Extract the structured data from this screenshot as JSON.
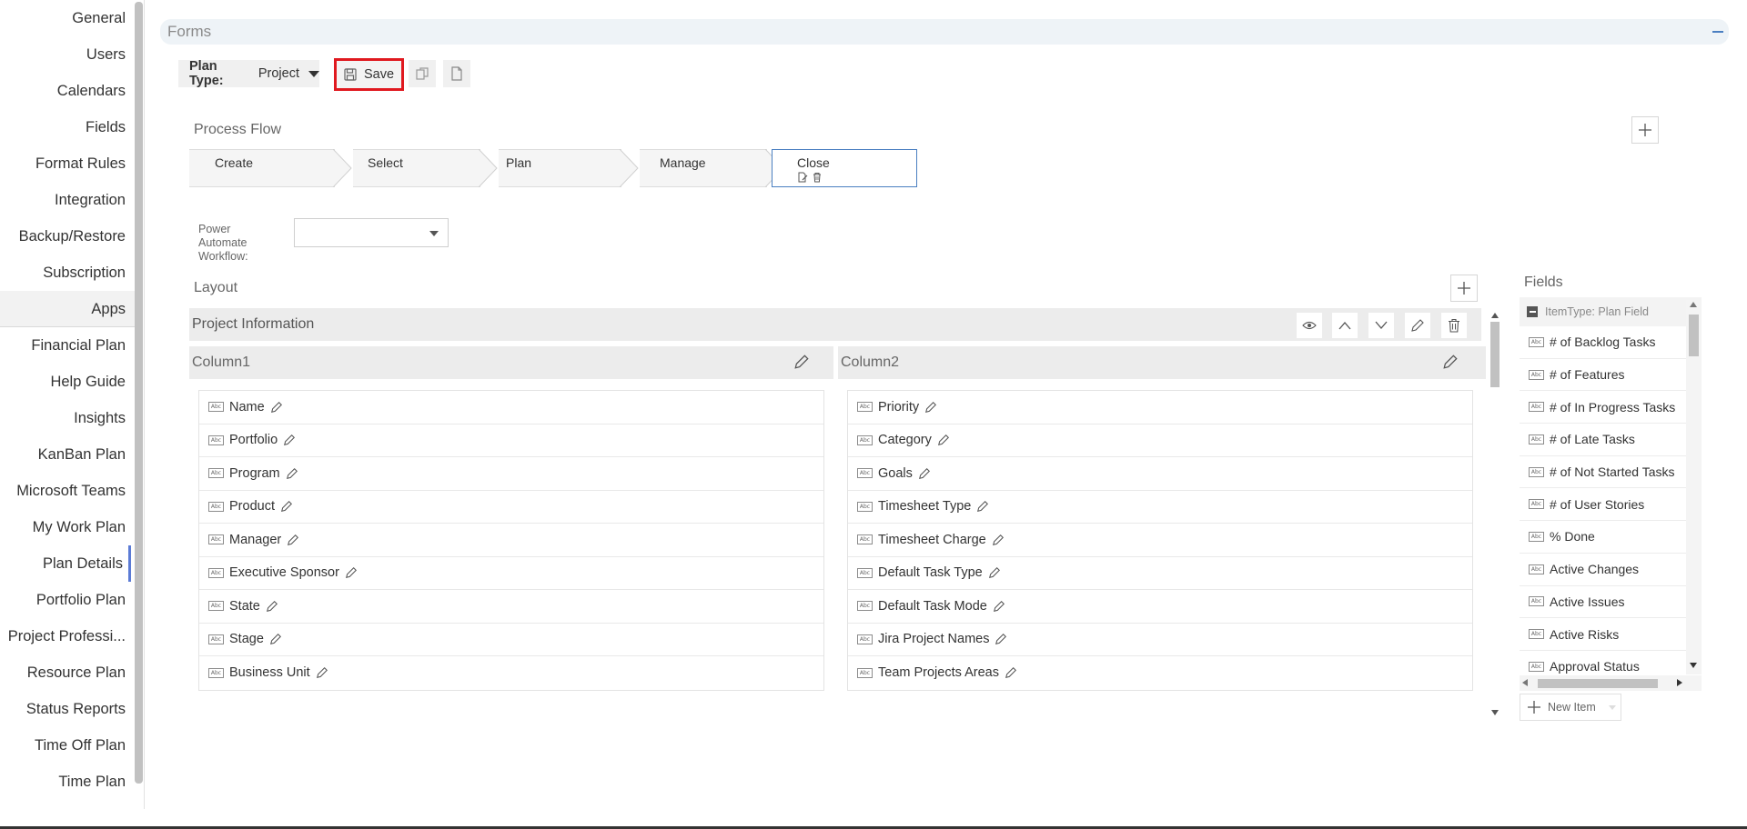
{
  "sidebar": {
    "items": [
      {
        "label": "General"
      },
      {
        "label": "Users"
      },
      {
        "label": "Calendars"
      },
      {
        "label": "Fields"
      },
      {
        "label": "Format Rules"
      },
      {
        "label": "Integration"
      },
      {
        "label": "Backup/Restore"
      },
      {
        "label": "Subscription"
      },
      {
        "label": "Apps"
      },
      {
        "label": "Financial Plan"
      },
      {
        "label": "Help Guide"
      },
      {
        "label": "Insights"
      },
      {
        "label": "KanBan Plan"
      },
      {
        "label": "Microsoft Teams"
      },
      {
        "label": "My Work Plan"
      },
      {
        "label": "Plan Details"
      },
      {
        "label": "Portfolio Plan"
      },
      {
        "label": "Project Professi..."
      },
      {
        "label": "Resource Plan"
      },
      {
        "label": "Status Reports"
      },
      {
        "label": "Time Off Plan"
      },
      {
        "label": "Time Plan"
      }
    ],
    "highlighted": "Apps",
    "selected": "Plan Details"
  },
  "forms": {
    "title": "Forms"
  },
  "toolbar": {
    "plan_type_label": "Plan Type:",
    "plan_type_value": "Project",
    "save_label": "Save"
  },
  "process_flow": {
    "title": "Process Flow",
    "steps": [
      {
        "label": "Create"
      },
      {
        "label": "Select"
      },
      {
        "label": "Plan"
      },
      {
        "label": "Manage"
      },
      {
        "label": "Close"
      }
    ]
  },
  "power_automate": {
    "label": "Power Automate Workflow:",
    "value": ""
  },
  "layout": {
    "title": "Layout",
    "section_title": "Project Information",
    "column1": {
      "title": "Column1",
      "fields": [
        "Name",
        "Portfolio",
        "Program",
        "Product",
        "Manager",
        "Executive Sponsor",
        "State",
        "Stage",
        "Business Unit"
      ]
    },
    "column2": {
      "title": "Column2",
      "fields": [
        "Priority",
        "Category",
        "Goals",
        "Timesheet Type",
        "Timesheet Charge",
        "Default Task Type",
        "Default Task Mode",
        "Jira Project Names",
        "Team Projects Areas"
      ]
    }
  },
  "fields_panel": {
    "title": "Fields",
    "group": "ItemType: Plan Field",
    "items": [
      "# of Backlog Tasks",
      "# of Features",
      "# of In Progress Tasks",
      "# of Late Tasks",
      "# of Not Started Tasks",
      "# of User Stories",
      "% Done",
      "Active Changes",
      "Active Issues",
      "Active Risks",
      "Approval Status"
    ],
    "new_item_label": "New Item"
  },
  "icons": {
    "field_type": "abc-text-icon",
    "abc_text": "Abc",
    "accent": "#4a7fc1",
    "save_highlight": "#e0191f"
  }
}
